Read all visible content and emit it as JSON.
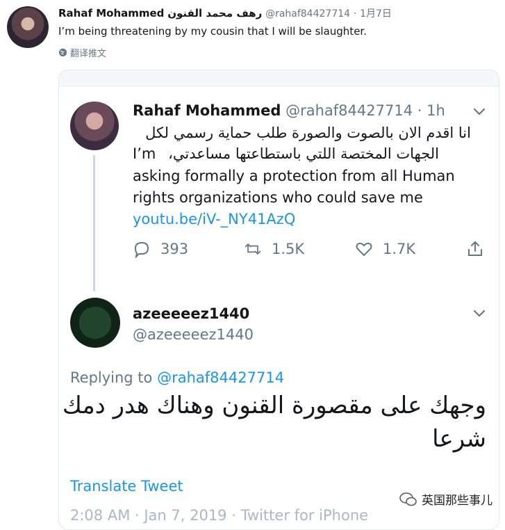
{
  "outer": {
    "name": "Rahaf Mohammed",
    "name_ar": "رهف محمد القنون",
    "handle": "@rahaf84427714",
    "dot": "·",
    "date": "1月7日",
    "text": "I’m being threatening by my cousin that I will be slaughter.",
    "translate": "翻译推文"
  },
  "quoted": {
    "name": "Rahaf Mohammed",
    "handle": "@rahaf84427714",
    "dot": "·",
    "time": "1h",
    "arabic_line1": "انا اقدم الان بالصوت والصورة طلب حماية رسمي لكل",
    "arabic_line2": "الجهات المختصة اللتي باستطاعتها مساعدتي،",
    "en_start": "I’m",
    "en_line2": "asking formally a protection from all Human",
    "en_line3": " rights organizations who could save me",
    "link": "youtu.be/iV-_NY41AzQ",
    "replies": "393",
    "retweets": "1.5K",
    "likes": "1.7K"
  },
  "reply": {
    "name": "azeeeeez1440",
    "handle": "@azeeeeez1440",
    "replying_prefix": "Replying to",
    "replying_to": "@rahaf84427714",
    "arabic_line1": "وجهك على مقصورة القنون وهناك هدر دمك",
    "arabic_line2": "شرعا",
    "translate": "Translate Tweet",
    "meta": "2:08 AM · Jan 7, 2019 · Twitter for iPhone"
  },
  "watermark": "英国那些事儿",
  "colors": {
    "link": "#1b95e0",
    "muted": "#657786",
    "text": "#14171a"
  },
  "icons": [
    "globe-icon",
    "chevron-down-icon",
    "reply-icon",
    "retweet-icon",
    "like-icon",
    "share-icon",
    "wechat-icon"
  ]
}
